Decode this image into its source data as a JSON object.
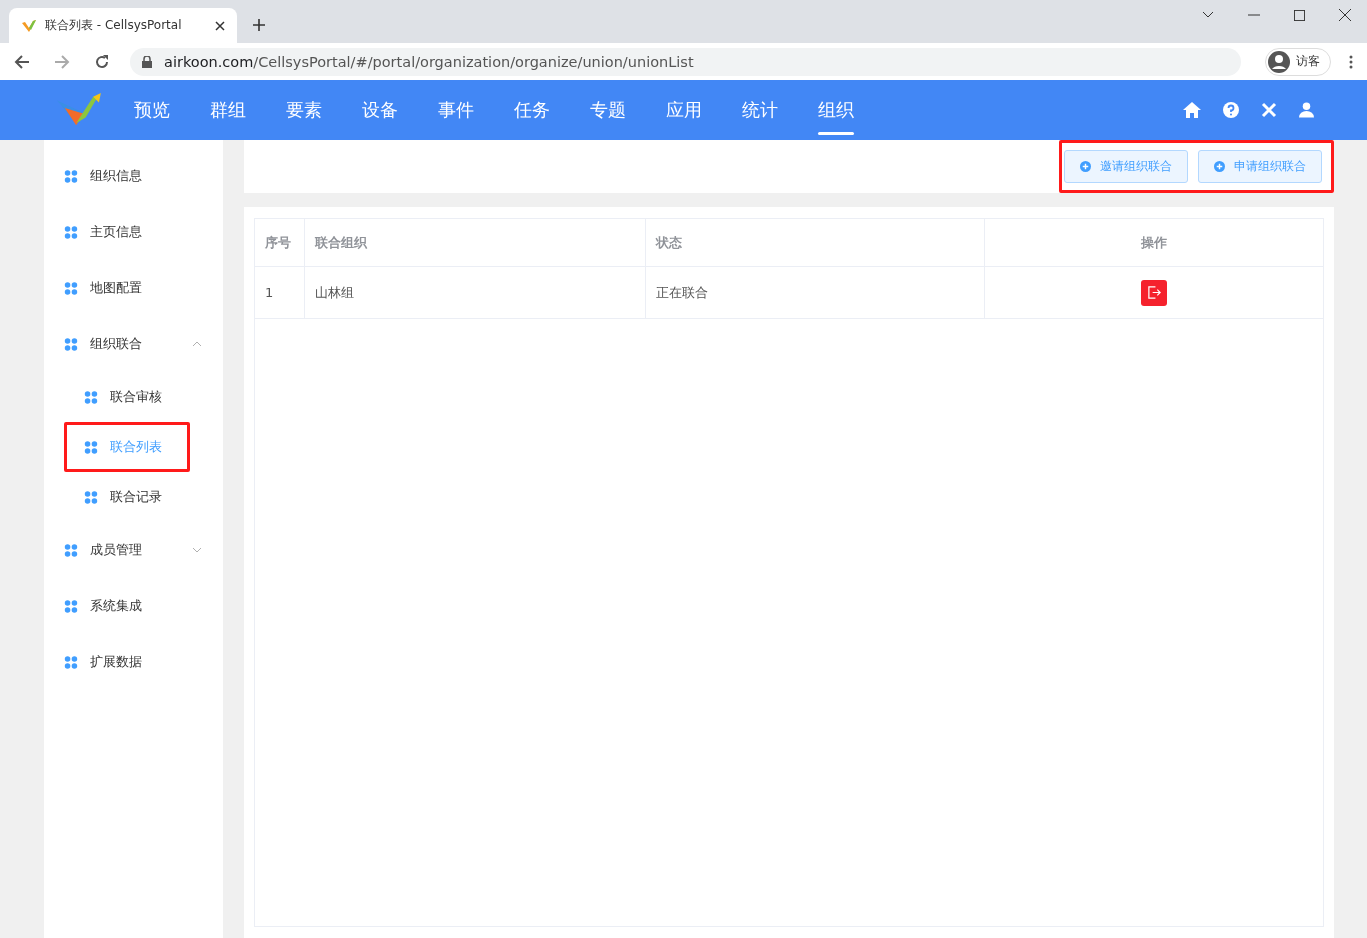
{
  "browser": {
    "tab_title": "联合列表 - CellsysPortal",
    "url_host": "airkoon.com",
    "url_path": "/CellsysPortal/#/portal/organization/organize/union/unionList",
    "profile": "访客"
  },
  "nav": {
    "items": [
      {
        "label": "预览",
        "selected": false
      },
      {
        "label": "群组",
        "selected": false
      },
      {
        "label": "要素",
        "selected": false
      },
      {
        "label": "设备",
        "selected": false
      },
      {
        "label": "事件",
        "selected": false
      },
      {
        "label": "任务",
        "selected": false
      },
      {
        "label": "专题",
        "selected": false
      },
      {
        "label": "应用",
        "selected": false
      },
      {
        "label": "统计",
        "selected": false
      },
      {
        "label": "组织",
        "selected": true
      }
    ]
  },
  "sidebar": {
    "items": [
      {
        "label": "组织信息"
      },
      {
        "label": "主页信息"
      },
      {
        "label": "地图配置"
      },
      {
        "label": "组织联合",
        "expanded": true,
        "children": [
          {
            "label": "联合审核",
            "selected": false,
            "highlighted": false
          },
          {
            "label": "联合列表",
            "selected": true,
            "highlighted": true
          },
          {
            "label": "联合记录",
            "selected": false,
            "highlighted": false
          }
        ]
      },
      {
        "label": "成员管理",
        "expanded": false
      },
      {
        "label": "系统集成"
      },
      {
        "label": "扩展数据"
      }
    ]
  },
  "actions": {
    "highlighted": true,
    "buttons": [
      "邀请组织联合",
      "申请组织联合"
    ]
  },
  "table": {
    "columns": [
      "序号",
      "联合组织",
      "状态",
      "操作"
    ],
    "rows": [
      {
        "cells": [
          "1",
          "山林组",
          "正在联合"
        ]
      }
    ]
  }
}
